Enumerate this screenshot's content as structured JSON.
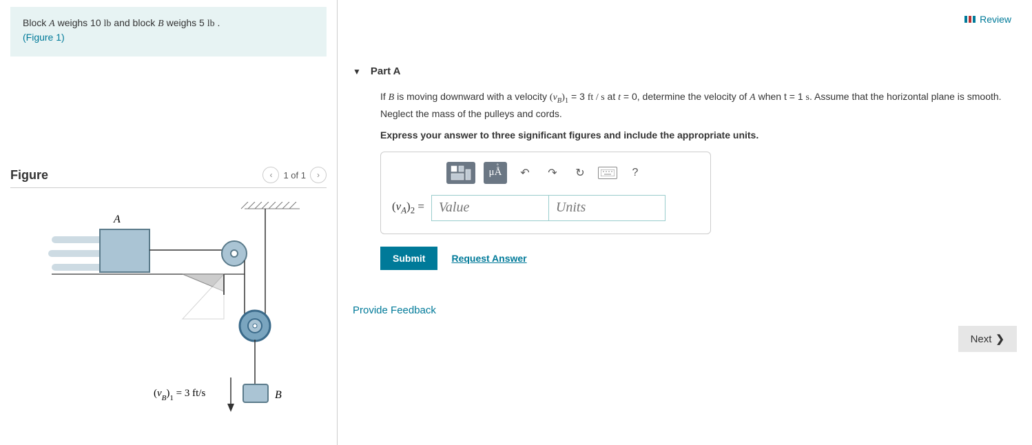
{
  "header": {
    "review_label": "Review"
  },
  "problem": {
    "text_prefix": "Block ",
    "blockA": "A",
    "text_mid1": " weighs 10 ",
    "unit1": "lb",
    "text_mid2": " and block ",
    "blockB": "B",
    "text_mid3": " weighs 5 ",
    "unit2": "lb",
    "text_suffix": " .",
    "figure_link": "(Figure 1)"
  },
  "figure": {
    "title": "Figure",
    "nav_text": "1 of 1",
    "labels": {
      "A": "A",
      "B": "B",
      "velocity_label": "(v_B)_1 = 3 ft/s"
    }
  },
  "part": {
    "title": "Part A",
    "question_line1_a": "If ",
    "question_line1_b": "B",
    "question_line1_c": " is moving downward with a velocity ",
    "question_line1_d": "(v_B)_1",
    "question_line1_e": " = 3 ",
    "question_line1_f": "ft / s",
    "question_line1_g": " at ",
    "question_line1_h": "t",
    "question_line1_i": " = 0, determine the velocity of ",
    "question_line1_j": "A",
    "question_line1_k": " when t = 1 ",
    "question_line1_l": "s",
    "question_line1_m": ". Assume that the horizontal plane is smooth. Neglect the mass of the pulleys and cords.",
    "instruction": "Express your answer to three significant figures and include the appropriate units."
  },
  "answer": {
    "var_label": "(v_A)_2 =",
    "value_placeholder": "Value",
    "units_placeholder": "Units",
    "toolbar": {
      "ua_label": "μÅ",
      "help_label": "?"
    }
  },
  "buttons": {
    "submit": "Submit",
    "request_answer": "Request Answer",
    "provide_feedback": "Provide Feedback",
    "next": "Next"
  }
}
